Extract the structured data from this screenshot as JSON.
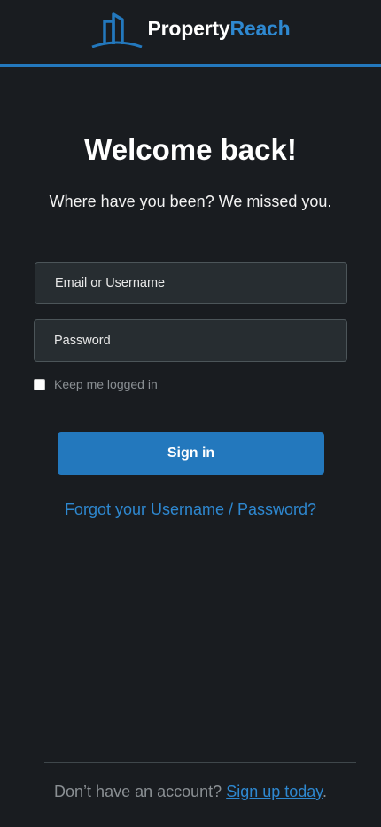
{
  "brand": {
    "name_part1": "Property",
    "name_part2": "Reach",
    "accent_color": "#2378bd",
    "logo_icon": "building-icon"
  },
  "main": {
    "title": "Welcome back!",
    "subtitle": "Where have you been? We missed you."
  },
  "form": {
    "email_placeholder": "Email or Username",
    "email_value": "",
    "password_placeholder": "Password",
    "password_value": "",
    "remember_label": "Keep me logged in",
    "remember_checked": false,
    "signin_label": "Sign in"
  },
  "links": {
    "forgot_label": "Forgot your Username / Password?"
  },
  "footer": {
    "prompt": "Don’t have an account?",
    "signup_label": "Sign up today",
    "suffix": "."
  }
}
